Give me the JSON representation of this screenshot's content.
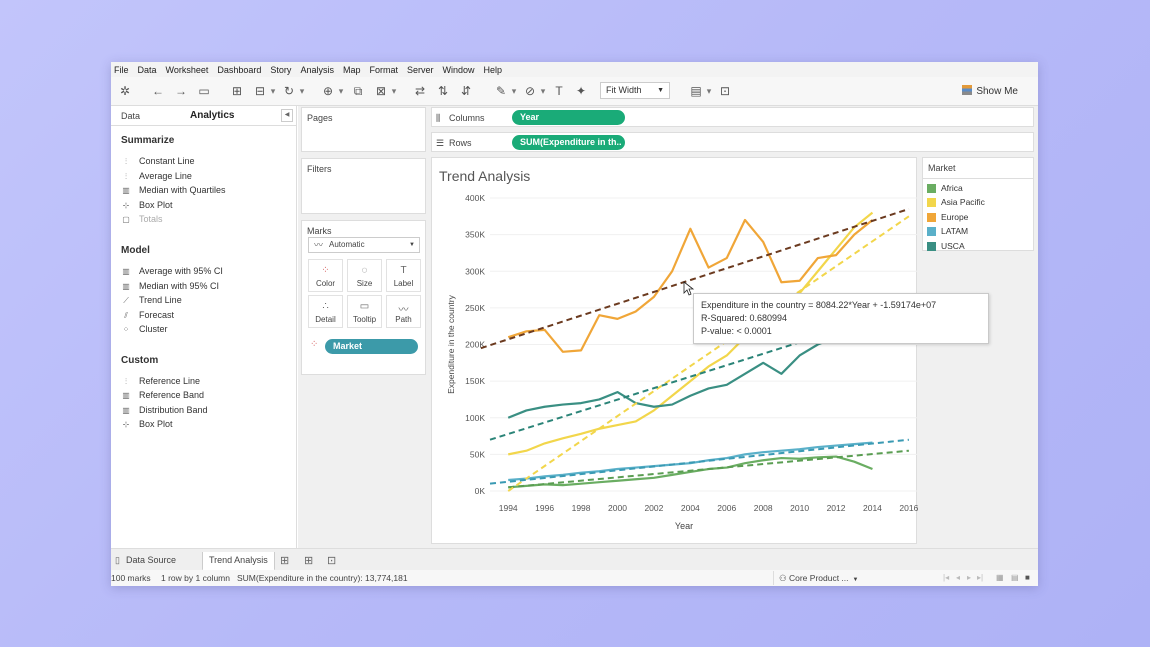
{
  "menu": [
    "File",
    "Data",
    "Worksheet",
    "Dashboard",
    "Story",
    "Analysis",
    "Map",
    "Format",
    "Server",
    "Window",
    "Help"
  ],
  "toolbar": {
    "fit_label": "Fit Width",
    "show_me": "Show Me"
  },
  "left_pane": {
    "tab_data": "Data",
    "tab_analytics": "Analytics",
    "summarize_title": "Summarize",
    "summarize_items": [
      "Constant Line",
      "Average Line",
      "Median with Quartiles",
      "Box Plot",
      "Totals"
    ],
    "model_title": "Model",
    "model_items": [
      "Average with 95% CI",
      "Median with 95% CI",
      "Trend Line",
      "Forecast",
      "Cluster"
    ],
    "custom_title": "Custom",
    "custom_items": [
      "Reference Line",
      "Reference Band",
      "Distribution Band",
      "Box Plot"
    ]
  },
  "cards": {
    "pages": "Pages",
    "filters": "Filters",
    "marks": "Marks",
    "marks_type": "Automatic",
    "marks_buttons": [
      "Color",
      "Size",
      "Label",
      "Detail",
      "Tooltip",
      "Path"
    ],
    "market_pill": "Market"
  },
  "shelves": {
    "columns_label": "Columns",
    "rows_label": "Rows",
    "columns_pill": "Year",
    "rows_pill": "SUM(Expenditure in th.."
  },
  "viz": {
    "title": "Trend Analysis"
  },
  "legend": {
    "title": "Market",
    "items": [
      {
        "label": "Africa",
        "color": "#6aad62"
      },
      {
        "label": "Asia Pacific",
        "color": "#f2d64b"
      },
      {
        "label": "Europe",
        "color": "#f0a638"
      },
      {
        "label": "LATAM",
        "color": "#5ab0c9"
      },
      {
        "label": "USCA",
        "color": "#3a8f83"
      }
    ]
  },
  "tooltip": {
    "line1": "Expenditure in the country = 8084.22*Year + -1.59174e+07",
    "line2": "R-Squared: 0.680994",
    "line3": "P-value: < 0.0001"
  },
  "bottom": {
    "data_source": "Data Source",
    "active_sheet": "Trend Analysis"
  },
  "status": {
    "marks": "100 marks",
    "rows_cols": "1 row by 1 column",
    "sum": "SUM(Expenditure in the country): 13,774,181",
    "user": "Core Product ..."
  },
  "chart_data": {
    "type": "line",
    "title": "Trend Analysis",
    "xlabel": "Year",
    "ylabel": "Expenditure in the country",
    "x_ticks": [
      "1994",
      "1996",
      "1998",
      "2000",
      "2002",
      "2004",
      "2006",
      "2008",
      "2010",
      "2012",
      "2014",
      "2016"
    ],
    "y_ticks": [
      "0K",
      "50K",
      "100K",
      "150K",
      "200K",
      "250K",
      "300K",
      "350K",
      "400K"
    ],
    "xlim": [
      1993,
      2016.5
    ],
    "ylim": [
      0,
      400000
    ],
    "x": [
      1994,
      1995,
      1996,
      1997,
      1998,
      1999,
      2000,
      2001,
      2002,
      2003,
      2004,
      2005,
      2006,
      2007,
      2008,
      2009,
      2010,
      2011,
      2012,
      2013,
      2014
    ],
    "series": [
      {
        "name": "Africa",
        "color": "#6aad62",
        "values": [
          5000,
          7000,
          9000,
          8000,
          10000,
          12000,
          14000,
          16000,
          18000,
          22000,
          26000,
          30000,
          32000,
          38000,
          42000,
          45000,
          44000,
          46000,
          47000,
          40000,
          30000
        ]
      },
      {
        "name": "Asia Pacific",
        "color": "#f2d64b",
        "values": [
          50000,
          55000,
          65000,
          72000,
          78000,
          85000,
          90000,
          95000,
          110000,
          130000,
          150000,
          170000,
          185000,
          210000,
          230000,
          250000,
          270000,
          300000,
          330000,
          360000,
          380000
        ]
      },
      {
        "name": "Europe",
        "color": "#f0a638",
        "values": [
          210000,
          218000,
          220000,
          190000,
          192000,
          240000,
          235000,
          245000,
          265000,
          300000,
          358000,
          305000,
          318000,
          370000,
          340000,
          285000,
          287000,
          318000,
          322000,
          350000,
          370000
        ]
      },
      {
        "name": "LATAM",
        "color": "#5ab0c9",
        "values": [
          15000,
          17000,
          20000,
          22000,
          25000,
          27000,
          30000,
          32000,
          34000,
          36000,
          38000,
          42000,
          45000,
          50000,
          53000,
          55000,
          57000,
          60000,
          62000,
          64000,
          66000
        ]
      },
      {
        "name": "USCA",
        "color": "#3a8f83",
        "values": [
          100000,
          110000,
          115000,
          118000,
          120000,
          125000,
          135000,
          120000,
          115000,
          118000,
          130000,
          140000,
          145000,
          160000,
          175000,
          160000,
          185000,
          200000,
          210000,
          220000,
          230000
        ]
      }
    ],
    "trend_lines": [
      {
        "name": "Africa",
        "color": "#5a9d52",
        "x0": 1994,
        "y0": 5000,
        "x1": 2016,
        "y1": 55000
      },
      {
        "name": "Asia Pacific",
        "color": "#f2d64b",
        "x0": 1994,
        "y0": 0,
        "x1": 2016,
        "y1": 375000
      },
      {
        "name": "Europe",
        "color": "#6b3a1f",
        "x0": 1992.5,
        "y0": 195000,
        "x1": 2016,
        "y1": 385000
      },
      {
        "name": "LATAM",
        "color": "#3a9ab3",
        "x0": 1993,
        "y0": 10000,
        "x1": 2016,
        "y1": 70000
      },
      {
        "name": "USCA",
        "color": "#2b8478",
        "x0": 1993,
        "y0": 70000,
        "x1": 2016,
        "y1": 250000
      }
    ]
  }
}
